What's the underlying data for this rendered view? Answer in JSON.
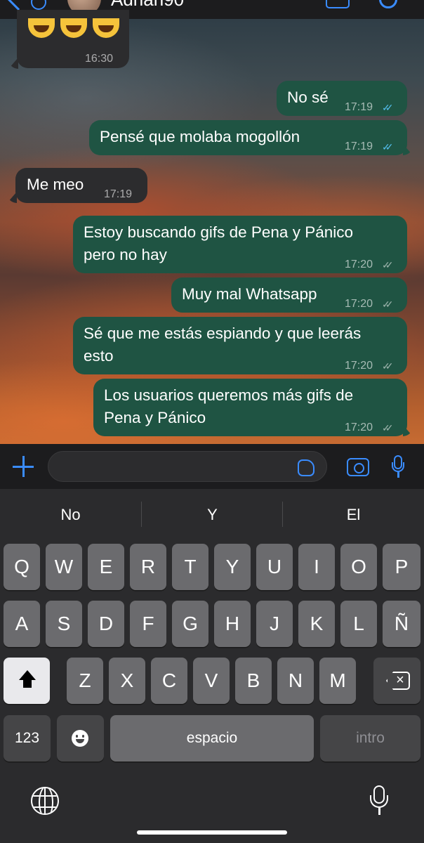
{
  "header": {
    "contact_name": "Adrian90"
  },
  "messages": [
    {
      "direction": "in",
      "text": "",
      "emoji": [
        "face-with-tears-of-joy",
        "face-with-tears-of-joy",
        "face-with-tears-of-joy"
      ],
      "time": "16:30"
    },
    {
      "direction": "out",
      "text": "No sé",
      "time": "17:19",
      "status": "read"
    },
    {
      "direction": "out",
      "text": "Pensé que molaba mogollón",
      "time": "17:19",
      "status": "read"
    },
    {
      "direction": "in",
      "text": "Me meo",
      "time": "17:19"
    },
    {
      "direction": "out",
      "text": "Estoy buscando gifs de Pena y Pánico",
      "text2": "pero no hay",
      "time": "17:20",
      "status": "delivered"
    },
    {
      "direction": "out",
      "text": "Muy mal Whatsapp",
      "time": "17:20",
      "status": "delivered"
    },
    {
      "direction": "out",
      "text": "Sé que me estás espiando y que leerás",
      "text2": "esto",
      "time": "17:20",
      "status": "delivered"
    },
    {
      "direction": "out",
      "text": "Los usuarios queremos más gifs de",
      "text2": "Pena y Pánico",
      "time": "17:20",
      "status": "delivered"
    }
  ],
  "colors": {
    "accent": "#3a8cff",
    "outgoing_bubble": "#1f5443",
    "incoming_bubble": "#2c2c2e",
    "read_ticks": "#53bdeb"
  },
  "input": {
    "value": "",
    "icons": [
      "plus-icon",
      "sticker-icon",
      "camera-icon",
      "microphone-icon"
    ]
  },
  "keyboard": {
    "suggestions": [
      "No",
      "Y",
      "El"
    ],
    "row1": [
      "Q",
      "W",
      "E",
      "R",
      "T",
      "Y",
      "U",
      "I",
      "O",
      "P"
    ],
    "row2": [
      "A",
      "S",
      "D",
      "F",
      "G",
      "H",
      "J",
      "K",
      "L",
      "Ñ"
    ],
    "row3": [
      "Z",
      "X",
      "C",
      "V",
      "B",
      "N",
      "M"
    ],
    "numbers_key": "123",
    "space_key": "espacio",
    "return_key": "intro"
  }
}
